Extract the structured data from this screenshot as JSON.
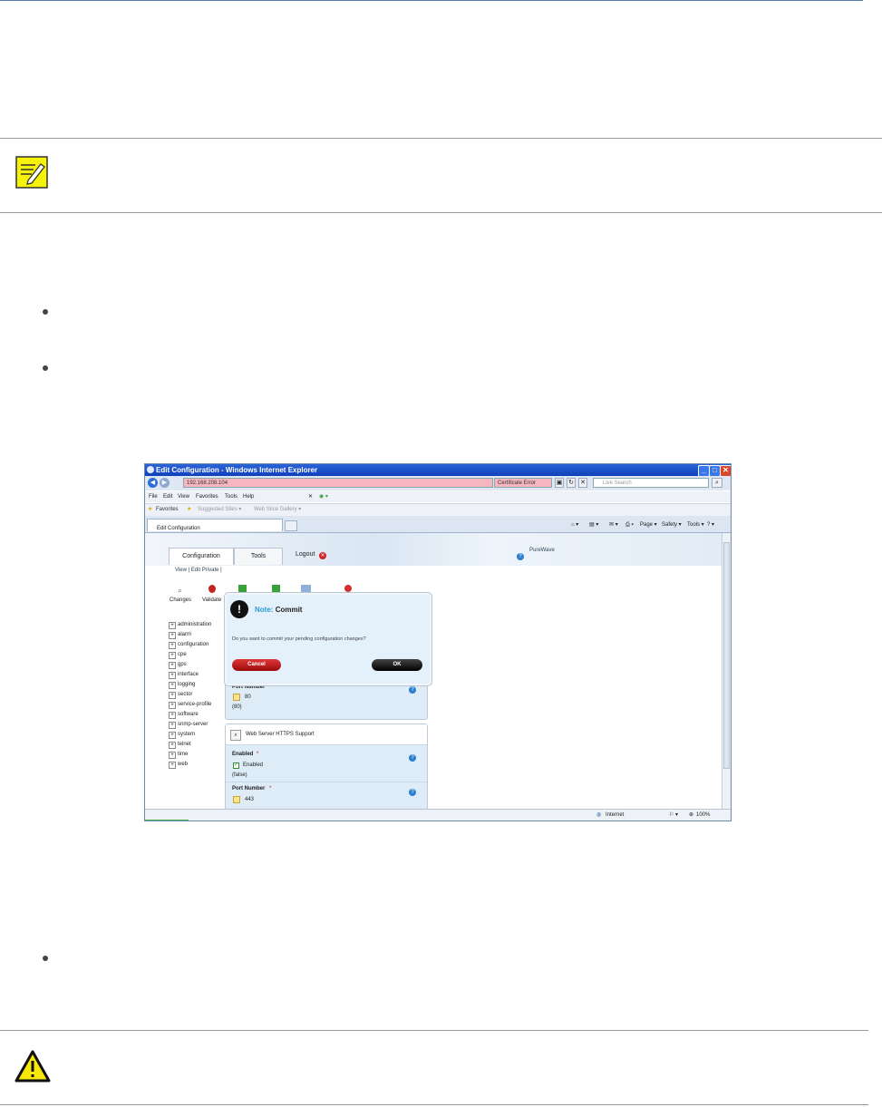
{
  "browser": {
    "window_title": "Edit Configuration - Windows Internet Explorer",
    "address": "192.168.208.104",
    "cert_error": "Certificate Error",
    "search_placeholder": "Live Search",
    "menu": [
      "File",
      "Edit",
      "View",
      "Favorites",
      "Tools",
      "Help"
    ],
    "favorites_label": "Favorites",
    "suggested_sites": "Suggested Sites ▾",
    "web_slice_gallery": "Web Slice Gallery ▾",
    "tab_title": "Edit Configuration",
    "commands": [
      "Page ▾",
      "Safety ▾",
      "Tools ▾"
    ],
    "status_zone": "Internet",
    "zoom": "100%"
  },
  "app": {
    "tabs": [
      "Configuration",
      "Tools"
    ],
    "logout": "Logout",
    "logo": "PureWave",
    "subnav": "View  |  Edit Private  |",
    "toolbar": [
      "Changes",
      "Validate"
    ],
    "tree": [
      "administration",
      "alarm",
      "configuration",
      "cpe",
      "gps",
      "interface",
      "logging",
      "sector",
      "service-profile",
      "software",
      "snmp-server",
      "system",
      "telnet",
      "time",
      "web"
    ],
    "panel1": {
      "port_label": "Port Number",
      "port_value": "80",
      "port_default": "(80)"
    },
    "panel2": {
      "title": "Web Server HTTPS Support",
      "enabled_label": "Enabled",
      "enabled_value": "Enabled",
      "enabled_default": "(false)",
      "port_label": "Port Number",
      "port_value": "443"
    },
    "required_mark": "*"
  },
  "dialog": {
    "title_prefix": "Note:",
    "title": "Commit",
    "message": "Do you want to commit your pending configuration changes?",
    "cancel": "Cancel",
    "ok": "OK"
  }
}
